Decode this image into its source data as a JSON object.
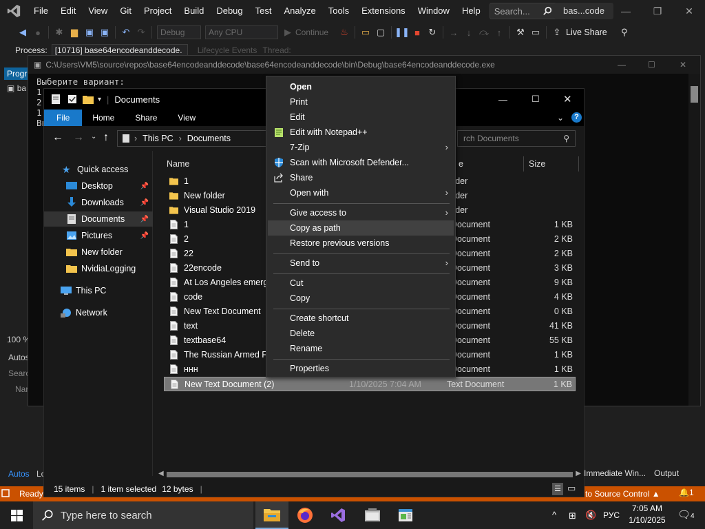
{
  "vs": {
    "menu": [
      "File",
      "Edit",
      "View",
      "Git",
      "Project",
      "Build",
      "Debug",
      "Test",
      "Analyze",
      "Tools",
      "Extensions",
      "Window",
      "Help"
    ],
    "search_label": "Search...",
    "solution_name": "bas...code",
    "live_share": "Live Share",
    "toolbar": {
      "config": "Debug",
      "platform": "Any CPU",
      "continue_label": "Continue"
    },
    "process_label": "Process:",
    "process_value": "[10716] base64encodeanddecode.",
    "lifecycle_label": "Lifecycle Events",
    "thread_label": "Thread:",
    "prog_tab": "Progr",
    "side_texts": {
      "ba": "ba",
      "zoom": "100 %",
      "autos_header": "Autos",
      "search": "Searc",
      "name": "Nar",
      "autos_tab": "Autos",
      "lo": "Lo"
    },
    "status_ready": "Ready",
    "source_control": "d to Source Control",
    "notif_count": "1",
    "immediate_tab": "Immediate Win...",
    "output_tab": "Output"
  },
  "console": {
    "title": "C:\\Users\\VM5\\source\\repos\\base64encodeanddecode\\base64encodeanddecode\\bin\\Debug\\base64encodeanddecode.exe",
    "lines": [
      "Выберите вариант:",
      "1.",
      "2.",
      "1",
      "Вве"
    ]
  },
  "explorer": {
    "title": "Documents",
    "ribbon": [
      "File",
      "Home",
      "Share",
      "View"
    ],
    "breadcrumb": [
      "This PC",
      "Documents"
    ],
    "search_placeholder": "rch Documents",
    "nav": [
      "Quick access",
      "Desktop",
      "Downloads",
      "Documents",
      "Pictures",
      "New folder",
      "NvidiaLogging",
      "This PC",
      "Network"
    ],
    "columns": {
      "name": "Name",
      "type": "e",
      "size": "Size"
    },
    "files": [
      {
        "name": "1",
        "date": "",
        "type": "folder",
        "size": "",
        "kind": "folder"
      },
      {
        "name": "New folder",
        "date": "",
        "type": "folder",
        "size": "",
        "kind": "folder"
      },
      {
        "name": "Visual Studio 2019",
        "date": "",
        "type": "folder",
        "size": "",
        "kind": "folder"
      },
      {
        "name": "1",
        "date": "",
        "type": "t Document",
        "size": "1 KB",
        "kind": "file"
      },
      {
        "name": "2",
        "date": "",
        "type": "t Document",
        "size": "2 KB",
        "kind": "file"
      },
      {
        "name": "22",
        "date": "",
        "type": "t Document",
        "size": "2 KB",
        "kind": "file"
      },
      {
        "name": "22encode",
        "date": "",
        "type": "t Document",
        "size": "3 KB",
        "kind": "file"
      },
      {
        "name": "At Los Angeles emerger",
        "date": "",
        "type": "t Document",
        "size": "9 KB",
        "kind": "file"
      },
      {
        "name": "code",
        "date": "",
        "type": "t Document",
        "size": "4 KB",
        "kind": "file"
      },
      {
        "name": "New Text Document",
        "date": "",
        "type": "t Document",
        "size": "0 KB",
        "kind": "file"
      },
      {
        "name": "text",
        "date": "",
        "type": "t Document",
        "size": "41 KB",
        "kind": "file"
      },
      {
        "name": "textbase64",
        "date": "",
        "type": "t Document",
        "size": "55 KB",
        "kind": "file"
      },
      {
        "name": "The Russian Armed Forc",
        "date": "",
        "type": "t Document",
        "size": "1 KB",
        "kind": "file"
      },
      {
        "name": "ннн",
        "date": "",
        "type": "t Document",
        "size": "1 KB",
        "kind": "file"
      },
      {
        "name": "New Text Document (2)",
        "date": "1/10/2025 7:04 AM",
        "type": "Text Document",
        "size": "1 KB",
        "kind": "file"
      }
    ],
    "status": {
      "items": "15 items",
      "selected": "1 item selected",
      "size": "12 bytes"
    }
  },
  "context_menu": {
    "open": "Open",
    "print": "Print",
    "edit": "Edit",
    "edit_npp": "Edit with Notepad++",
    "zip": "7-Zip",
    "defender": "Scan with Microsoft Defender...",
    "share": "Share",
    "open_with": "Open with",
    "give_access": "Give access to",
    "copy_path": "Copy as path",
    "restore": "Restore previous versions",
    "send_to": "Send to",
    "cut": "Cut",
    "copy": "Copy",
    "shortcut": "Create shortcut",
    "delete": "Delete",
    "rename": "Rename",
    "properties": "Properties"
  },
  "taskbar": {
    "search_placeholder": "Type here to search",
    "lang": "РУС",
    "time": "7:05 AM",
    "date": "1/10/2025",
    "notif_count": "4"
  }
}
